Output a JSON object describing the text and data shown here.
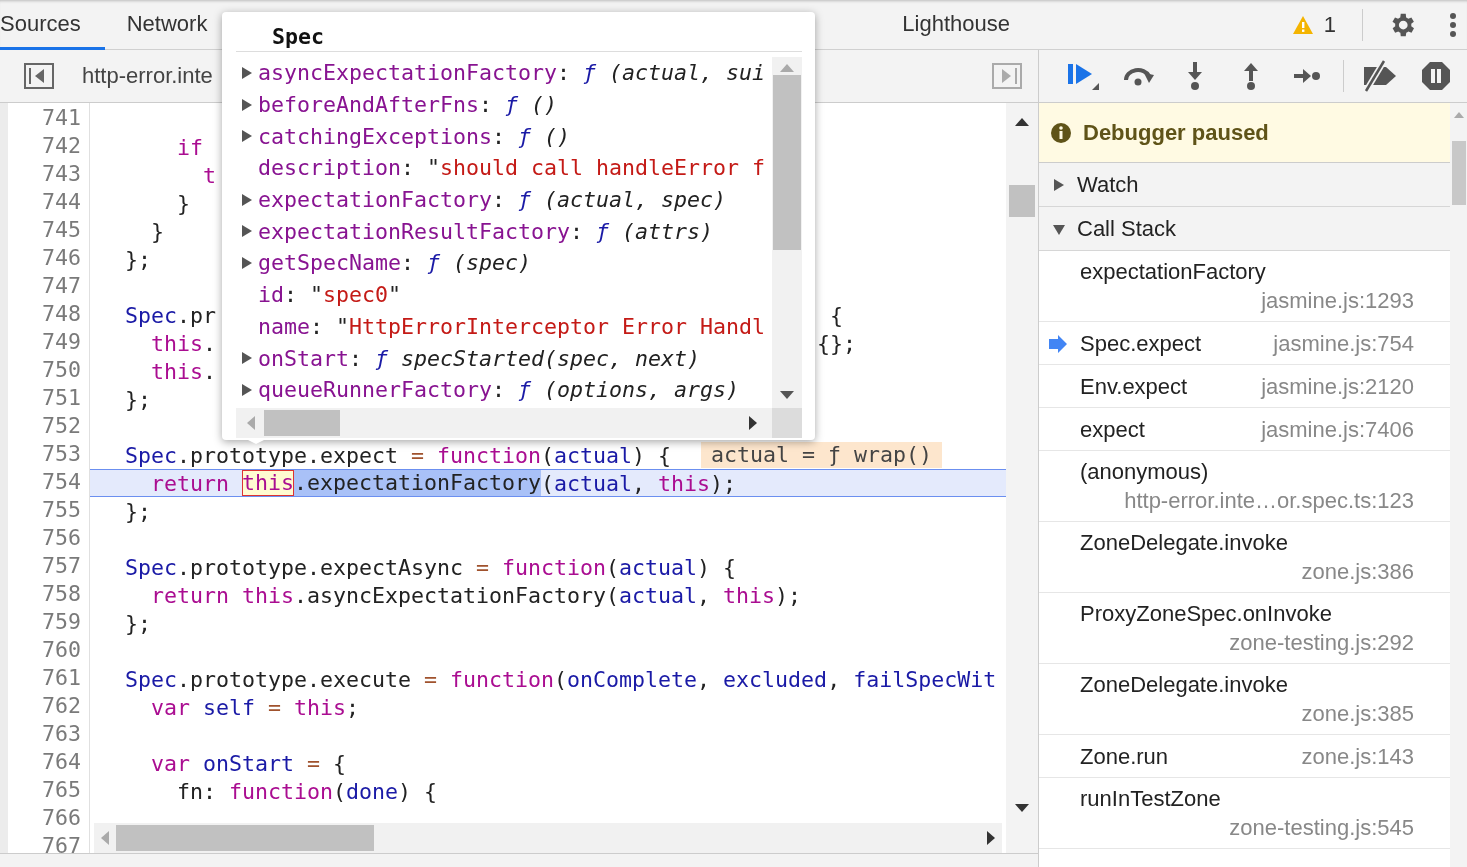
{
  "tabs": [
    {
      "label": "Sources",
      "selected": true
    },
    {
      "label": "Network",
      "selected": false
    },
    {
      "label": "Lighthouse",
      "selected": false
    }
  ],
  "warnings": {
    "count": "1"
  },
  "editor": {
    "file_tab": "http-error.inte",
    "lines": [
      {
        "num": "741",
        "current": false
      },
      {
        "num": "742",
        "current": false,
        "tokens": [
          {
            "kind": "kw",
            "text": "    if"
          }
        ]
      },
      {
        "num": "743",
        "current": false,
        "tokens": [
          {
            "kind": "kw",
            "text": "      t"
          }
        ]
      },
      {
        "num": "744",
        "current": false,
        "tokens": [
          {
            "kind": "plain",
            "text": "    }"
          }
        ]
      },
      {
        "num": "745",
        "current": false,
        "tokens": [
          {
            "kind": "plain",
            "text": "  }"
          }
        ]
      },
      {
        "num": "746",
        "current": false,
        "tokens": [
          {
            "kind": "plain",
            "text": "};"
          }
        ]
      },
      {
        "num": "747",
        "current": false
      },
      {
        "num": "748",
        "current": false,
        "tokens": [
          {
            "kind": "def",
            "text": "Spec"
          },
          {
            "kind": "plain",
            "text": ".pr"
          }
        ],
        "tail": [
          {
            "kind": "plain",
            "text": " {"
          }
        ]
      },
      {
        "num": "749",
        "current": false,
        "tokens": [
          {
            "kind": "kw",
            "text": "  this"
          },
          {
            "kind": "plain",
            "text": "."
          }
        ],
        "tail": [
          {
            "kind": "plain",
            "text": "{};"
          }
        ]
      },
      {
        "num": "750",
        "current": false,
        "tokens": [
          {
            "kind": "kw",
            "text": "  this"
          },
          {
            "kind": "plain",
            "text": "."
          }
        ]
      },
      {
        "num": "751",
        "current": false,
        "tokens": [
          {
            "kind": "plain",
            "text": "};"
          }
        ]
      },
      {
        "num": "752",
        "current": false
      },
      {
        "num": "753",
        "current": false,
        "tokens": [
          {
            "kind": "def",
            "text": "Spec"
          },
          {
            "kind": "plain",
            "text": ".prototype.expect "
          },
          {
            "kind": "op",
            "text": "="
          },
          {
            "kind": "kw",
            "text": " function"
          },
          {
            "kind": "plain",
            "text": "("
          },
          {
            "kind": "def",
            "text": "actual"
          },
          {
            "kind": "plain",
            "text": ") {"
          },
          {
            "kind": "inline",
            "text": "actual = ƒ wrap()"
          }
        ]
      },
      {
        "num": "754",
        "current": true,
        "tokens": [
          {
            "kind": "kw",
            "text": "  return "
          },
          {
            "kind": "hover",
            "text": "this"
          },
          {
            "kind": "sel",
            "text": ".expectationFactory"
          },
          {
            "kind": "plain",
            "text": "("
          },
          {
            "kind": "def",
            "text": "actual"
          },
          {
            "kind": "plain",
            "text": ", "
          },
          {
            "kind": "kw",
            "text": "this"
          },
          {
            "kind": "plain",
            "text": ");"
          }
        ]
      },
      {
        "num": "755",
        "current": false,
        "tokens": [
          {
            "kind": "plain",
            "text": "};"
          }
        ]
      },
      {
        "num": "756",
        "current": false
      },
      {
        "num": "757",
        "current": false,
        "tokens": [
          {
            "kind": "def",
            "text": "Spec"
          },
          {
            "kind": "plain",
            "text": ".prototype.expectAsync "
          },
          {
            "kind": "op",
            "text": "="
          },
          {
            "kind": "kw",
            "text": " function"
          },
          {
            "kind": "plain",
            "text": "("
          },
          {
            "kind": "def",
            "text": "actual"
          },
          {
            "kind": "plain",
            "text": ") {"
          }
        ]
      },
      {
        "num": "758",
        "current": false,
        "tokens": [
          {
            "kind": "kw",
            "text": "  return this"
          },
          {
            "kind": "plain",
            "text": ".asyncExpectationFactory("
          },
          {
            "kind": "def",
            "text": "actual"
          },
          {
            "kind": "plain",
            "text": ", "
          },
          {
            "kind": "kw",
            "text": "this"
          },
          {
            "kind": "plain",
            "text": ");"
          }
        ]
      },
      {
        "num": "759",
        "current": false,
        "tokens": [
          {
            "kind": "plain",
            "text": "};"
          }
        ]
      },
      {
        "num": "760",
        "current": false
      },
      {
        "num": "761",
        "current": false,
        "tokens": [
          {
            "kind": "def",
            "text": "Spec"
          },
          {
            "kind": "plain",
            "text": ".prototype.execute "
          },
          {
            "kind": "op",
            "text": "="
          },
          {
            "kind": "kw",
            "text": " function"
          },
          {
            "kind": "plain",
            "text": "("
          },
          {
            "kind": "def",
            "text": "onComplete"
          },
          {
            "kind": "plain",
            "text": ", "
          },
          {
            "kind": "def",
            "text": "excluded"
          },
          {
            "kind": "plain",
            "text": ", "
          },
          {
            "kind": "def",
            "text": "failSpecWit"
          }
        ]
      },
      {
        "num": "762",
        "current": false,
        "tokens": [
          {
            "kind": "kw",
            "text": "  var"
          },
          {
            "kind": "def",
            "text": " self"
          },
          {
            "kind": "op",
            "text": " ="
          },
          {
            "kind": "kw",
            "text": " this"
          },
          {
            "kind": "plain",
            "text": ";"
          }
        ]
      },
      {
        "num": "763",
        "current": false
      },
      {
        "num": "764",
        "current": false,
        "tokens": [
          {
            "kind": "kw",
            "text": "  var"
          },
          {
            "kind": "def",
            "text": " onStart"
          },
          {
            "kind": "op",
            "text": " ="
          },
          {
            "kind": "plain",
            "text": " {"
          }
        ]
      },
      {
        "num": "765",
        "current": false,
        "tokens": [
          {
            "kind": "plain",
            "text": "    fn: "
          },
          {
            "kind": "kw",
            "text": "function"
          },
          {
            "kind": "plain",
            "text": "("
          },
          {
            "kind": "def",
            "text": "done"
          },
          {
            "kind": "plain",
            "text": ") {"
          }
        ]
      },
      {
        "num": "766",
        "current": false
      },
      {
        "num": "767",
        "current": false
      }
    ]
  },
  "popover": {
    "title": "Spec",
    "properties": [
      {
        "key": "asyncExpectationFactory",
        "expandable": true,
        "value": [
          {
            "kind": "plain",
            "text": ": "
          },
          {
            "kind": "fn",
            "text": "ƒ"
          },
          {
            "kind": "it",
            "text": " (actual, sui"
          }
        ]
      },
      {
        "key": "beforeAndAfterFns",
        "expandable": true,
        "value": [
          {
            "kind": "plain",
            "text": ": "
          },
          {
            "kind": "fn",
            "text": "ƒ"
          },
          {
            "kind": "it",
            "text": " ()"
          }
        ]
      },
      {
        "key": "catchingExceptions",
        "expandable": true,
        "value": [
          {
            "kind": "plain",
            "text": ": "
          },
          {
            "kind": "fn",
            "text": "ƒ"
          },
          {
            "kind": "it",
            "text": " ()"
          }
        ]
      },
      {
        "key": "description",
        "expandable": false,
        "value": [
          {
            "kind": "plain",
            "text": ": \""
          },
          {
            "kind": "str",
            "text": "should call handleError f"
          }
        ]
      },
      {
        "key": "expectationFactory",
        "expandable": true,
        "value": [
          {
            "kind": "plain",
            "text": ": "
          },
          {
            "kind": "fn",
            "text": "ƒ"
          },
          {
            "kind": "it",
            "text": " (actual, spec)"
          }
        ]
      },
      {
        "key": "expectationResultFactory",
        "expandable": true,
        "value": [
          {
            "kind": "plain",
            "text": ": "
          },
          {
            "kind": "fn",
            "text": "ƒ"
          },
          {
            "kind": "it",
            "text": " (attrs)"
          }
        ]
      },
      {
        "key": "getSpecName",
        "expandable": true,
        "value": [
          {
            "kind": "plain",
            "text": ": "
          },
          {
            "kind": "fn",
            "text": "ƒ"
          },
          {
            "kind": "it",
            "text": " (spec)"
          }
        ]
      },
      {
        "key": "id",
        "expandable": false,
        "value": [
          {
            "kind": "plain",
            "text": ": \""
          },
          {
            "kind": "str",
            "text": "spec0"
          },
          {
            "kind": "plain",
            "text": "\""
          }
        ]
      },
      {
        "key": "name",
        "expandable": false,
        "value": [
          {
            "kind": "plain",
            "text": ": \""
          },
          {
            "kind": "str",
            "text": "HttpErrorInterceptor Error Handl"
          }
        ]
      },
      {
        "key": "onStart",
        "expandable": true,
        "value": [
          {
            "kind": "plain",
            "text": ": "
          },
          {
            "kind": "fn",
            "text": "ƒ"
          },
          {
            "kind": "it",
            "text": " specStarted(spec, next)"
          }
        ]
      },
      {
        "key": "queueRunnerFactory",
        "expandable": true,
        "value": [
          {
            "kind": "plain",
            "text": ": "
          },
          {
            "kind": "fn",
            "text": "ƒ"
          },
          {
            "kind": "it",
            "text": " (options, args)"
          }
        ]
      }
    ]
  },
  "debugger": {
    "status": "Debugger paused",
    "sections": [
      {
        "label": "Watch",
        "expanded": false
      },
      {
        "label": "Call Stack",
        "expanded": true
      }
    ],
    "call_stack": [
      {
        "name": "expectationFactory",
        "location": "jasmine.js:1293",
        "current": false
      },
      {
        "name": "Spec.expect",
        "location": "jasmine.js:754",
        "current": true
      },
      {
        "name": "Env.expect",
        "location": "jasmine.js:2120",
        "current": false
      },
      {
        "name": "expect",
        "location": "jasmine.js:7406",
        "current": false
      },
      {
        "name": "(anonymous)",
        "location": "http-error.inte…or.spec.ts:123",
        "current": false
      },
      {
        "name": "ZoneDelegate.invoke",
        "location": "zone.js:386",
        "current": false
      },
      {
        "name": "ProxyZoneSpec.onInvoke",
        "location": "zone-testing.js:292",
        "current": false
      },
      {
        "name": "ZoneDelegate.invoke",
        "location": "zone.js:385",
        "current": false
      },
      {
        "name": "Zone.run",
        "location": "zone.js:143",
        "current": false
      },
      {
        "name": "runInTestZone",
        "location": "zone-testing.js:545",
        "current": false
      }
    ]
  }
}
